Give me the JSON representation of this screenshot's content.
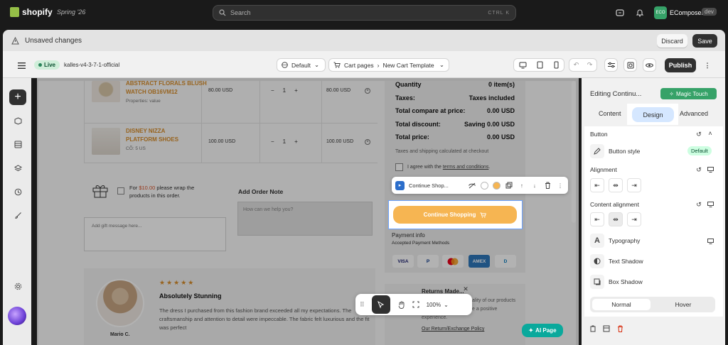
{
  "topbar": {
    "logo": "shopify",
    "edition": "Spring '26",
    "search_placeholder": "Search",
    "search_shortcut": "CTRL K",
    "store_initials": "ECO",
    "store_name": "EComposer",
    "store_badge": "dev"
  },
  "unsaved": {
    "label": "Unsaved changes",
    "discard": "Discard",
    "save": "Save"
  },
  "editor": {
    "live": "Live",
    "theme_name": "kalles-v4-3-7-1-official",
    "locale": "Default",
    "page_type": "Cart pages",
    "template": "New Cart Template",
    "publish": "Publish"
  },
  "cart": {
    "items": [
      {
        "name_line1": "Abstract Florals Blush",
        "name_line2": "Watch OB16VM12",
        "meta": "Properties: value",
        "price": "80.00 USD",
        "qty": "1",
        "total": "80.00 USD"
      },
      {
        "name_line1": "DISNEY NIZZA",
        "name_line2": "PLATFORM SHOES",
        "meta": "CÕ: 5 US",
        "price": "100.00 USD",
        "qty": "1",
        "total": "100.00 USD"
      }
    ],
    "gift_prefix": "For ",
    "gift_amount": "$10.00",
    "gift_suffix": " please wrap the",
    "gift_line2": "products in this order.",
    "gift_placeholder": "Add gift message here...",
    "order_note_title": "Add Order Note",
    "order_note_placeholder": "How can we help you?"
  },
  "summary": {
    "quantity_label": "Quantity",
    "quantity_value": "0 item(s)",
    "taxes_label": "Taxes:",
    "taxes_value": "Taxes included",
    "compare_label": "Total compare at price:",
    "compare_value": "0.00 USD",
    "discount_label": "Total discount:",
    "discount_value": "Saving 0.00 USD",
    "total_label": "Total price:",
    "total_value": "0.00 USD",
    "tax_note": "Taxes and shipping calculated at checkout",
    "agree_prefix": "I agree with the ",
    "agree_link": "terms and conditions",
    "agree_suffix": ".",
    "toolbar_label": "Continue Shop...",
    "button_label": "Continue Shopping",
    "payment_info": "Payment info",
    "payment_accepted": "Accepted Payment Methods",
    "cards": [
      "VISA",
      "P",
      "MC",
      "AMEX",
      "D"
    ]
  },
  "review": {
    "stars": "★★★★★",
    "title": "Absolutely Stunning",
    "body": "The dress I purchased from this fashion brand exceeded all my expectations. The craftsmanship and attention to detail were impeccable. The fabric felt luxurious and the fit was perfect",
    "author": "Mario C."
  },
  "returns": {
    "title": "Returns Made...",
    "body1": "ality of our products",
    "body2": "e a positive",
    "body3": "experience.",
    "link": "Our Return/Exchange Policy"
  },
  "canvas_tools": {
    "zoom": "100%"
  },
  "ai_page": "AI Page",
  "panel": {
    "title": "Editing Continu...",
    "magic": "Magic Touch",
    "tabs": {
      "content": "Content",
      "design": "Design",
      "advanced": "Advanced"
    },
    "section": "Button",
    "button_style": "Button style",
    "button_style_value": "Default",
    "alignment": "Alignment",
    "content_alignment": "Content alignment",
    "typography": "Typography",
    "text_shadow": "Text Shadow",
    "box_shadow": "Box Shadow",
    "state_normal": "Normal",
    "state_hover": "Hover"
  },
  "colors": {
    "accent_button": "#f6b552",
    "live_green": "#29845a",
    "magic_green": "#36a268",
    "ai_teal": "#0aa99c",
    "price_orange": "#d98e2b"
  }
}
